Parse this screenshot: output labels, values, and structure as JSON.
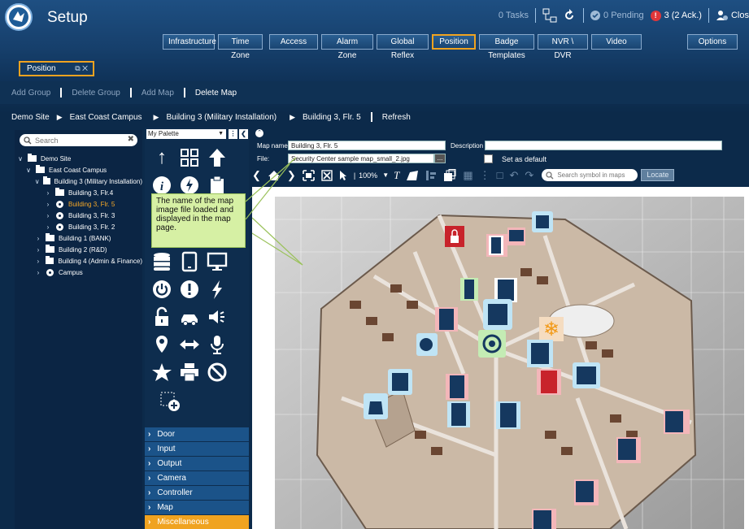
{
  "app": {
    "title": "Setup"
  },
  "status": {
    "tasks": "0 Tasks",
    "pending": "0 Pending",
    "alarms": "3",
    "ack": "(2 Ack.)",
    "close": "Clos"
  },
  "task_tabs": [
    "Infrastructure",
    "Time Zone",
    "Access",
    "Alarm Zone",
    "Global Reflex",
    "Position",
    "Badge Templates",
    "NVR \\ DVR",
    "Video",
    "Options"
  ],
  "module_tab": {
    "label": "Position"
  },
  "actions": [
    "Add Group",
    "Delete Group",
    "Add Map",
    "Delete Map"
  ],
  "breadcrumb": [
    "Demo Site",
    "East Coast Campus",
    "Building 3 (Military Installation)",
    "Building 3, Flr. 5",
    "Refresh"
  ],
  "tree": {
    "search_placeholder": "Search",
    "nodes": [
      "Demo Site",
      "East Coast Campus",
      "Building 3 (Military Installation)",
      "Building 3, Flr.4",
      "Building 3, Flr. 5",
      "Building 3, Flr. 3",
      "Building 3, Flr. 2",
      "Building 1 (BANK)",
      "Building 2 (R&D)",
      "Building 4 (Admin & Finance)",
      "Campus"
    ]
  },
  "palette": {
    "selected": "My Palette",
    "categories": [
      "Door",
      "Input",
      "Output",
      "Camera",
      "Controller",
      "Map",
      "Miscellaneous"
    ]
  },
  "properties": {
    "map_name_label": "Map name",
    "map_name": "Building 3, Flr. 5",
    "description_label": "Description",
    "description": "",
    "file_label": "File:",
    "file": "Security Center sample map_small_2.jpg",
    "browse": "...",
    "set_default": "Set as default"
  },
  "toolbar": {
    "zoom": "100%",
    "search_placeholder": "Search symbol in maps",
    "locate": "Locate"
  },
  "callout": {
    "text": "The name of the map image file loaded and displayed in the map page."
  },
  "colors": {
    "accent": "#f0a320",
    "header": "#1e4f82",
    "panel": "#0b2544",
    "callout": "#d6f0a4"
  }
}
